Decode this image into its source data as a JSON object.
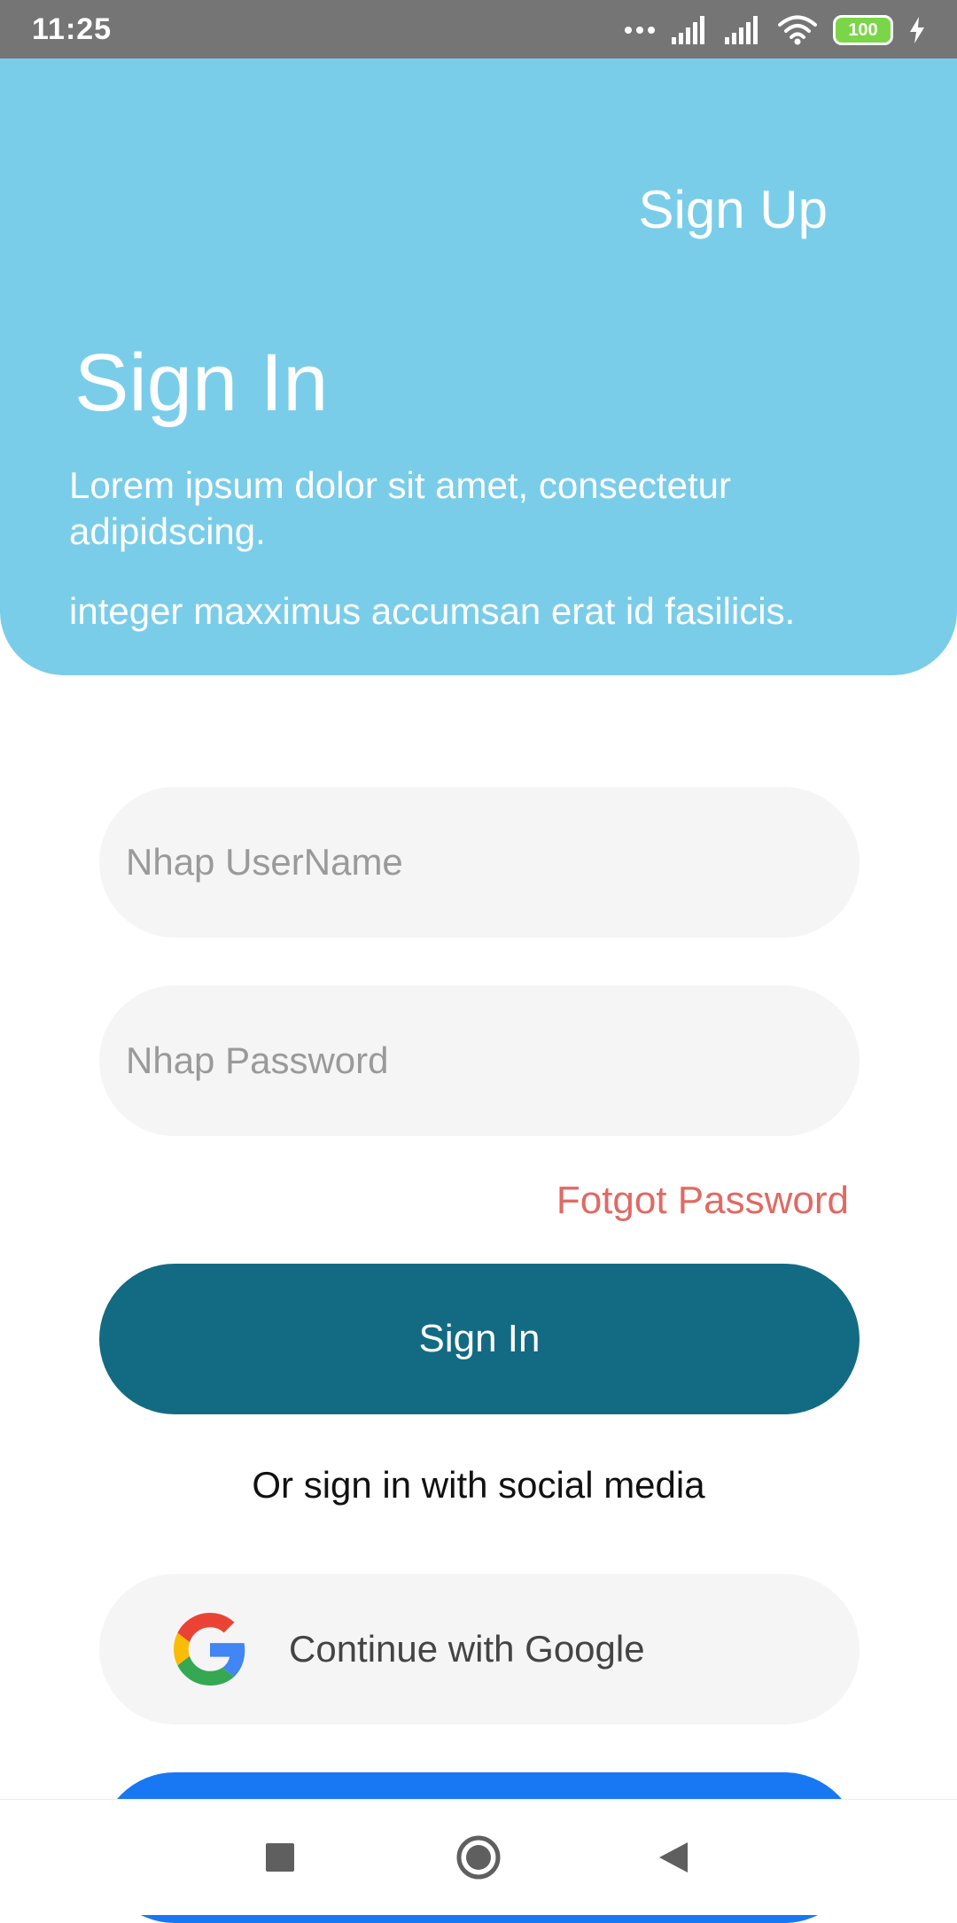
{
  "status_bar": {
    "time": "11:25",
    "battery": "100",
    "icons": [
      "dots-icon",
      "signal-icon",
      "signal-icon",
      "wifi-icon",
      "battery-icon",
      "charging-icon"
    ]
  },
  "header": {
    "signup_label": "Sign Up",
    "title": "Sign In",
    "description": "Lorem ipsum dolor sit amet, consectetur adipidscing.",
    "description_2": "integer maxximus accumsan erat id fasilicis.",
    "background_color": "#7acde9"
  },
  "form": {
    "username": {
      "value": "",
      "placeholder": "Nhap UserName"
    },
    "password": {
      "value": "",
      "placeholder": "Nhap Password"
    },
    "forgot_label": "Fotgot Password",
    "signin_label": "Sign In",
    "signin_color": "#136a83",
    "forgot_color": "#e06a64"
  },
  "social": {
    "caption": "Or sign in with social media",
    "google_label": "Continue with Google",
    "facebook_color": "#1877f2"
  },
  "nav": {
    "icons": [
      "recents-icon",
      "home-icon",
      "back-icon"
    ]
  }
}
